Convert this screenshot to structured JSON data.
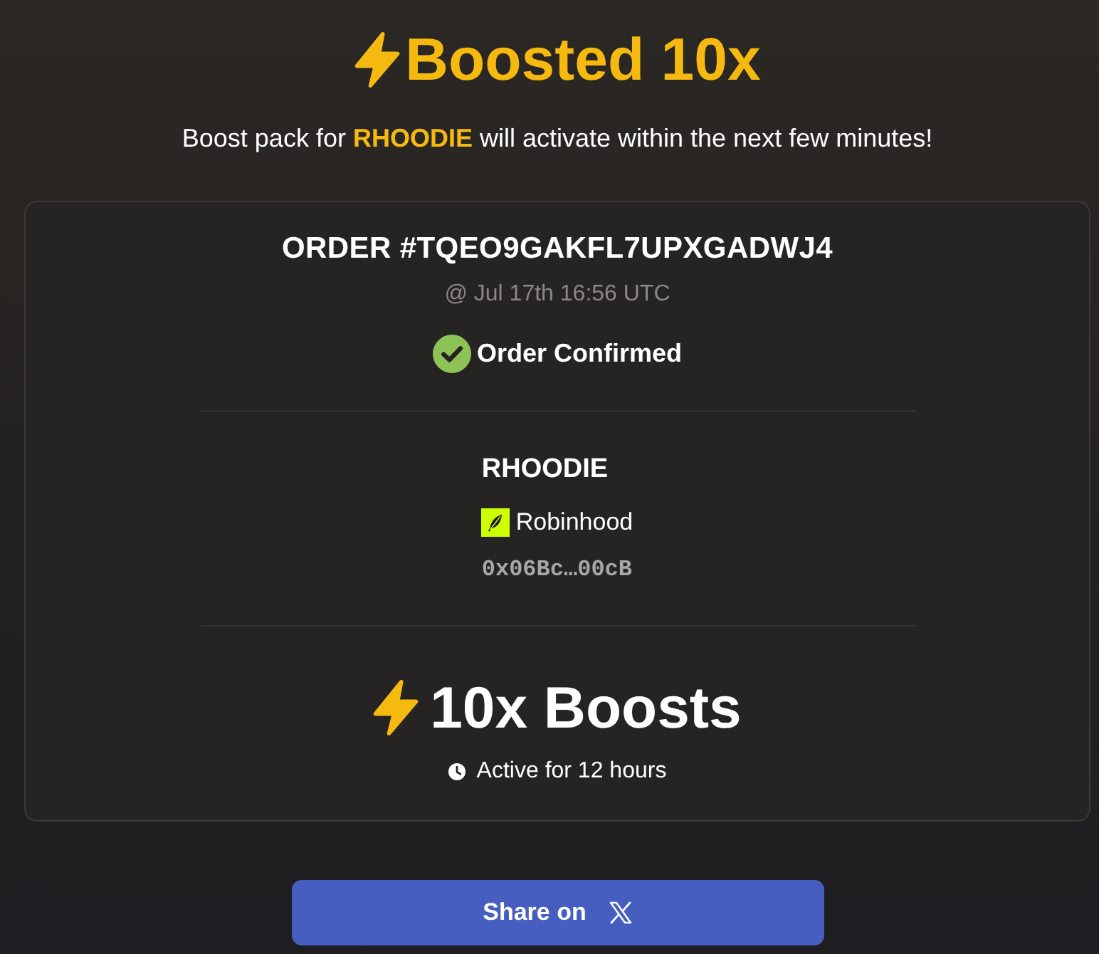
{
  "header": {
    "title": "Boosted 10x",
    "subtitle": "Boost pack for **RHOODIE** will activate within the next few minutes!"
  },
  "order": {
    "number": "ORDER #TQEO9GAKFL7UPXGADWJ4",
    "timestamp": "@ Jul 17th 16:56 UTC",
    "status": {
      "label": "Order Confirmed",
      "confirmed": true
    }
  },
  "token": {
    "symbol": "RHOODIE",
    "chain": "Robinhood",
    "address": "0x06Bc…00cB"
  },
  "boost": {
    "title": "10x Boosts",
    "duration": "Active for 12 hours"
  },
  "share_button": {
    "label": "Share on"
  }
}
